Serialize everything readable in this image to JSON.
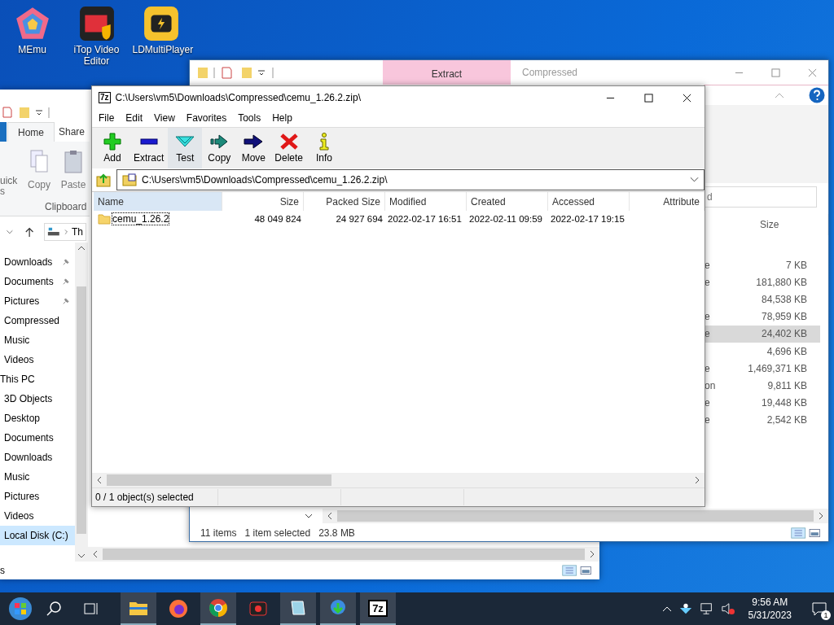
{
  "desktop_icons": [
    {
      "label": "MEmu",
      "kind": "memu"
    },
    {
      "label": "iTop Video Editor",
      "kind": "itop"
    },
    {
      "label": "LDMultiPlayer",
      "kind": "ld"
    }
  ],
  "back_window": {
    "ribbon_tab": {
      "label": "Extract",
      "selected": true
    },
    "title": "Compressed",
    "search": {
      "placeholder": "d"
    },
    "column_header": "Size",
    "rows": [
      {
        "type_fragment": "e",
        "size": "7 KB",
        "selected": false
      },
      {
        "type_fragment": "e",
        "size": "181,880 KB",
        "selected": false
      },
      {
        "size": "84,538 KB",
        "selected": false
      },
      {
        "type_fragment": "e",
        "size": "78,959 KB",
        "selected": false
      },
      {
        "type_fragment": "e",
        "size": "24,402 KB",
        "selected": true
      },
      {
        "size": "4,696 KB",
        "selected": false
      },
      {
        "type_fragment": "e",
        "size": "1,469,371 KB",
        "selected": false
      },
      {
        "type_fragment": "on",
        "size": "9,811 KB",
        "selected": false
      },
      {
        "type_fragment": "e",
        "size": "19,448 KB",
        "selected": false
      },
      {
        "type_fragment": "e",
        "size": "2,542 KB",
        "selected": false
      }
    ],
    "status": [
      "11 items",
      "1 item selected",
      "23.8 MB"
    ]
  },
  "left_window": {
    "tabs": [
      {
        "label": "Home",
        "selected": true
      },
      {
        "label": "Share",
        "selected": false
      }
    ],
    "ribbon_partial": [
      "uick",
      "s"
    ],
    "ribbon_buttons": [
      {
        "label": "Copy",
        "kind": "copy"
      },
      {
        "label": "Paste",
        "kind": "paste"
      }
    ],
    "ribbon_group": "Clipboard",
    "breadcrumb": "Th",
    "nav": [
      {
        "label": "Downloads",
        "kind": "item",
        "pinned": true,
        "selected": false
      },
      {
        "label": "Documents",
        "kind": "item",
        "pinned": true,
        "selected": false
      },
      {
        "label": "Pictures",
        "kind": "item",
        "pinned": true,
        "selected": false
      },
      {
        "label": "Compressed",
        "kind": "item",
        "pinned": false,
        "selected": false
      },
      {
        "label": "Music",
        "kind": "item",
        "pinned": false,
        "selected": false
      },
      {
        "label": "Videos",
        "kind": "item",
        "pinned": false,
        "selected": false
      },
      {
        "label": "This PC",
        "kind": "header",
        "pinned": false,
        "selected": false
      },
      {
        "label": "3D Objects",
        "kind": "item",
        "pinned": false,
        "selected": false
      },
      {
        "label": "Desktop",
        "kind": "item",
        "pinned": false,
        "selected": false
      },
      {
        "label": "Documents",
        "kind": "item",
        "pinned": false,
        "selected": false
      },
      {
        "label": "Downloads",
        "kind": "item",
        "pinned": false,
        "selected": false
      },
      {
        "label": "Music",
        "kind": "item",
        "pinned": false,
        "selected": false
      },
      {
        "label": "Pictures",
        "kind": "item",
        "pinned": false,
        "selected": false
      },
      {
        "label": "Videos",
        "kind": "item",
        "pinned": false,
        "selected": false
      },
      {
        "label": "Local Disk (C:)",
        "kind": "item",
        "pinned": false,
        "selected": true
      }
    ],
    "status": "s"
  },
  "window": {
    "icon_text": "7z",
    "title": "C:\\Users\\vm5\\Downloads\\Compressed\\cemu_1.26.2.zip\\",
    "menu": [
      "File",
      "Edit",
      "View",
      "Favorites",
      "Tools",
      "Help"
    ],
    "toolbar": [
      {
        "label": "Add",
        "kind": "add",
        "hovered": false
      },
      {
        "label": "Extract",
        "kind": "extract",
        "hovered": false
      },
      {
        "label": "Test",
        "kind": "test",
        "hovered": true
      },
      {
        "label": "Copy",
        "kind": "copy",
        "hovered": false
      },
      {
        "label": "Move",
        "kind": "move",
        "hovered": false
      },
      {
        "label": "Delete",
        "kind": "delete",
        "hovered": false
      },
      {
        "label": "Info",
        "kind": "info",
        "hovered": false
      }
    ],
    "address": "C:\\Users\\vm5\\Downloads\\Compressed\\cemu_1.26.2.zip\\",
    "columns": [
      {
        "label": "Name",
        "highlighted": true
      },
      {
        "label": "Size",
        "highlighted": false
      },
      {
        "label": "Packed Size",
        "highlighted": false
      },
      {
        "label": "Modified",
        "highlighted": false
      },
      {
        "label": "Created",
        "highlighted": false
      },
      {
        "label": "Accessed",
        "highlighted": false
      },
      {
        "label": "Attribute",
        "highlighted": false
      }
    ],
    "rows": [
      {
        "name": "cemu_1.26.2",
        "size": "48 049 824",
        "packed_size": "24 927 694",
        "modified": "2022-02-17 16:51",
        "created": "2022-02-11 09:59",
        "accessed": "2022-02-17 19:15",
        "focused": true
      }
    ],
    "status": "0 / 1 object(s) selected"
  },
  "taskbar": {
    "items": [
      {
        "kind": "explorer",
        "active": true
      },
      {
        "kind": "firefox",
        "active": false
      },
      {
        "kind": "chrome",
        "active": true
      },
      {
        "kind": "recorder",
        "active": false
      },
      {
        "kind": "notepad",
        "active": true
      },
      {
        "kind": "idm",
        "active": true
      },
      {
        "kind": "sevenzip",
        "active": true,
        "label": "7z"
      }
    ],
    "time": "9:56 AM",
    "date": "5/31/2023",
    "notifications": "1"
  }
}
